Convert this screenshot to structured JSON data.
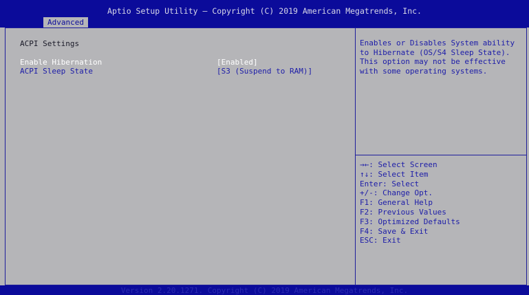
{
  "header": {
    "title": "Aptio Setup Utility – Copyright (C) 2019 American Megatrends, Inc.",
    "active_tab": "Advanced"
  },
  "main": {
    "section_title": "ACPI Settings",
    "settings": [
      {
        "label": "Enable Hibernation",
        "value": "[Enabled]"
      },
      {
        "label": "ACPI Sleep State",
        "value": "[S3 (Suspend to RAM)]"
      }
    ]
  },
  "help": {
    "text": "Enables or Disables System ability to Hibernate (OS/S4 Sleep State). This option may not be effective with some operating systems."
  },
  "keys": [
    "→←: Select Screen",
    "↑↓: Select Item",
    "Enter: Select",
    "+/-: Change Opt.",
    "F1: General Help",
    "F2: Previous Values",
    "F3: Optimized Defaults",
    "F4: Save & Exit",
    "ESC: Exit"
  ],
  "footer": {
    "text": "Version 2.20.1271. Copyright (C) 2019 American Megatrends, Inc."
  },
  "colors": {
    "header_bg": "#0b0b9a",
    "panel_bg": "#b5b5b8",
    "accent_text": "#1c1ca8",
    "selected_text": "#ffffff"
  }
}
